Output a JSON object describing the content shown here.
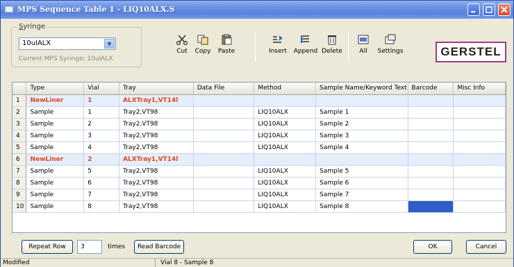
{
  "window": {
    "title": "MPS Sequence Table 1 - LIQ10ALX.S"
  },
  "syringe": {
    "legend_accel": "S",
    "legend_rest": "yringe",
    "selected": "10ulALX",
    "current": "Current MPS Syringe: 10ulALX"
  },
  "toolbar": {
    "cut": "Cut",
    "copy": "Copy",
    "paste": "Paste",
    "insert": "Insert",
    "append": "Append",
    "delete": "Delete",
    "all": "All",
    "settings": "Settings"
  },
  "brand": {
    "logo": "GERSTEL"
  },
  "table": {
    "columns": [
      "",
      "Type",
      "Vial",
      "Tray",
      "Data File",
      "Method",
      "Sample Name/Keyword Text",
      "Barcode",
      "Misc Info"
    ],
    "rows": [
      {
        "n": "1",
        "type": "NewLiner",
        "vial": "1",
        "tray": "ALXTray1,VT14l",
        "file": "",
        "method": "",
        "sample": "",
        "barcode": "",
        "misc": ""
      },
      {
        "n": "2",
        "type": "Sample",
        "vial": "1",
        "tray": "Tray2,VT98",
        "file": "",
        "method": "LIQ10ALX",
        "sample": "Sample 1",
        "barcode": "",
        "misc": ""
      },
      {
        "n": "3",
        "type": "Sample",
        "vial": "2",
        "tray": "Tray2,VT98",
        "file": "",
        "method": "LIQ10ALX",
        "sample": "Sample 2",
        "barcode": "",
        "misc": ""
      },
      {
        "n": "4",
        "type": "Sample",
        "vial": "3",
        "tray": "Tray2,VT98",
        "file": "",
        "method": "LIQ10ALX",
        "sample": "Sample 3",
        "barcode": "",
        "misc": ""
      },
      {
        "n": "5",
        "type": "Sample",
        "vial": "4",
        "tray": "Tray2,VT98",
        "file": "",
        "method": "LIQ10ALX",
        "sample": "Sample 4",
        "barcode": "",
        "misc": ""
      },
      {
        "n": "6",
        "type": "NewLiner",
        "vial": "2",
        "tray": "ALXTray1,VT14l",
        "file": "",
        "method": "",
        "sample": "",
        "barcode": "",
        "misc": ""
      },
      {
        "n": "7",
        "type": "Sample",
        "vial": "5",
        "tray": "Tray2,VT98",
        "file": "",
        "method": "LIQ10ALX",
        "sample": "Sample 5",
        "barcode": "",
        "misc": ""
      },
      {
        "n": "8",
        "type": "Sample",
        "vial": "6",
        "tray": "Tray2,VT98",
        "file": "",
        "method": "LIQ10ALX",
        "sample": "Sample 6",
        "barcode": "",
        "misc": ""
      },
      {
        "n": "9",
        "type": "Sample",
        "vial": "7",
        "tray": "Tray2,VT98",
        "file": "",
        "method": "LIQ10ALX",
        "sample": "Sample 7",
        "barcode": "",
        "misc": ""
      },
      {
        "n": "10",
        "type": "Sample",
        "vial": "8",
        "tray": "Tray2,VT98",
        "file": "",
        "method": "LIQ10ALX",
        "sample": "Sample 8",
        "barcode": "",
        "misc": ""
      }
    ]
  },
  "bottom": {
    "repeat_row": "Repeat Row",
    "repeat_count": "3",
    "times": "times",
    "read_barcode": "Read Barcode",
    "ok": "OK",
    "cancel": "Cancel"
  },
  "status": {
    "left": "Modified",
    "right": "Vial 8 - Sample 8"
  },
  "colors": {
    "accent": "#e04818",
    "selection": "#2e5fc8",
    "logo_border": "#9a3c8c"
  }
}
